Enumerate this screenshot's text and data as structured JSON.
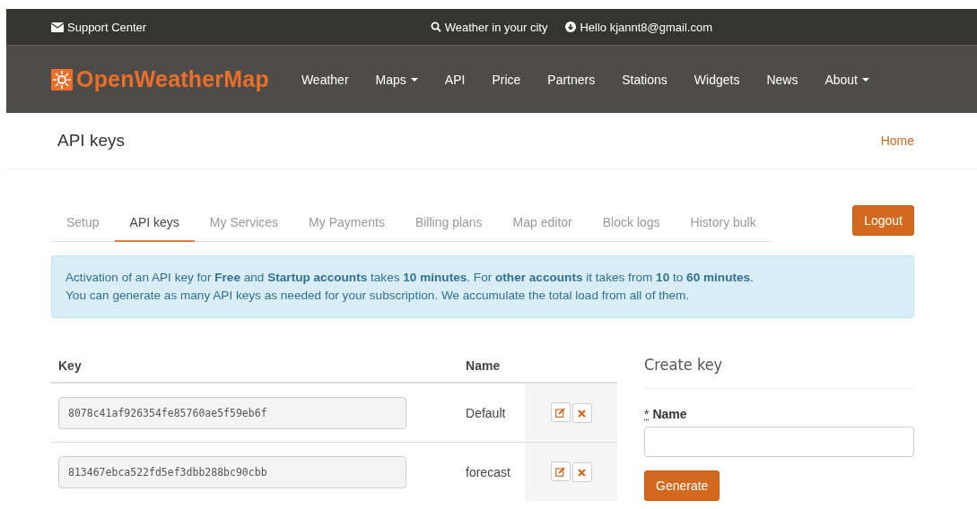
{
  "top_bar": {
    "support": "Support Center",
    "search": "Weather in your city",
    "user": "Hello kjannt8@gmail.com"
  },
  "nav": {
    "logo": "OpenWeatherMap",
    "items": [
      {
        "label": "Weather",
        "dropdown": false
      },
      {
        "label": "Maps",
        "dropdown": true
      },
      {
        "label": "API",
        "dropdown": false
      },
      {
        "label": "Price",
        "dropdown": false
      },
      {
        "label": "Partners",
        "dropdown": false
      },
      {
        "label": "Stations",
        "dropdown": false
      },
      {
        "label": "Widgets",
        "dropdown": false
      },
      {
        "label": "News",
        "dropdown": false
      },
      {
        "label": "About",
        "dropdown": true
      }
    ]
  },
  "page_header": {
    "title": "API keys",
    "breadcrumb": "Home"
  },
  "tabs": [
    {
      "label": "Setup",
      "selected": false
    },
    {
      "label": "API keys",
      "selected": true
    },
    {
      "label": "My Services",
      "selected": false
    },
    {
      "label": "My Payments",
      "selected": false
    },
    {
      "label": "Billing plans",
      "selected": false
    },
    {
      "label": "Map editor",
      "selected": false
    },
    {
      "label": "Block logs",
      "selected": false
    },
    {
      "label": "History bulk",
      "selected": false
    }
  ],
  "logout": "Logout",
  "notice": [
    "Activation of an API key for **Free** and **Startup accounts** takes **10 minutes**. For **other accounts** it takes from **10** to **60 minutes**.",
    "You can generate as many API keys as needed for your subscription. We accumulate the total load from all of them."
  ],
  "keys_table": {
    "columns": [
      "Key",
      "Name"
    ],
    "rows": [
      {
        "key": "8078c41af926354fe85760ae5f59eb6f",
        "name": "Default"
      },
      {
        "key": "813467ebca522fd5ef3dbb288bc90cbb",
        "name": "forecast"
      }
    ]
  },
  "create_key": {
    "title": "Create key",
    "required_mark": "*",
    "label": "Name",
    "button": "Generate"
  }
}
